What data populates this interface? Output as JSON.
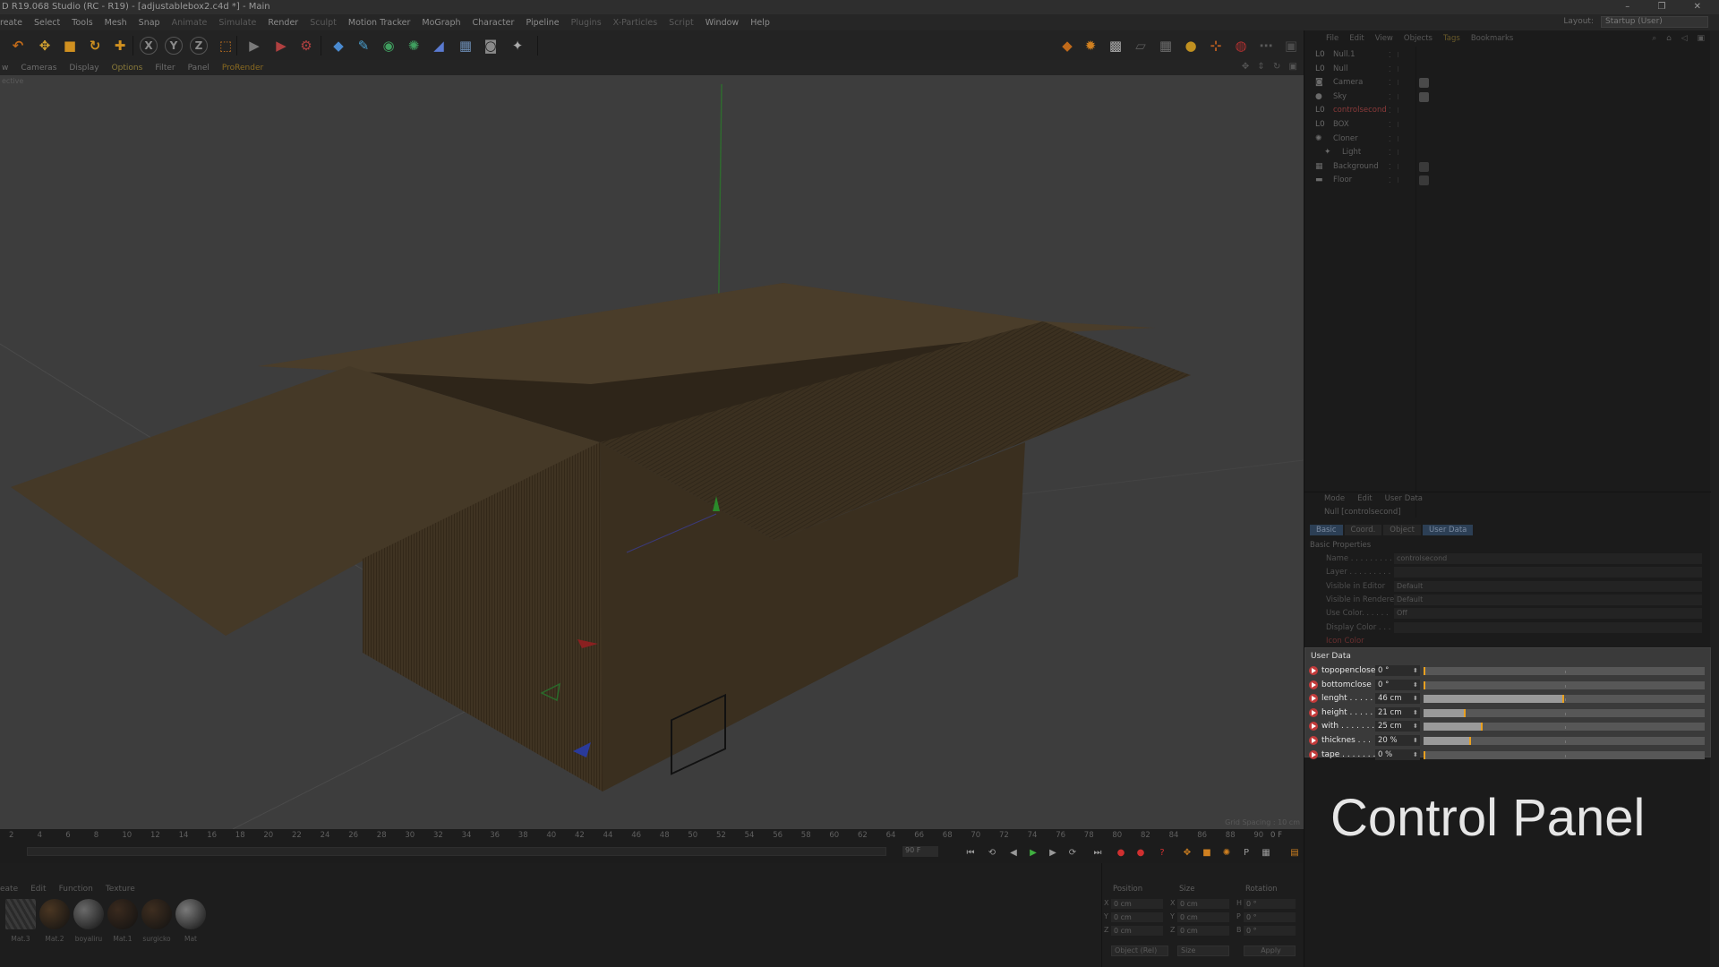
{
  "window": {
    "title": "D R19.068 Studio (RC - R19) - [adjustablebox2.c4d *] - Main",
    "controls": [
      "–",
      "❐",
      "✕"
    ]
  },
  "menubar": {
    "items": [
      "reate",
      "Select",
      "Tools",
      "Mesh",
      "Snap",
      "Animate",
      "Simulate",
      "Render",
      "Sculpt",
      "Motion Tracker",
      "MoGraph",
      "Character",
      "Pipeline",
      "Plugins",
      "X-Particles",
      "Script",
      "Window",
      "Help"
    ],
    "layout_label": "Layout:",
    "layout_value": "Startup (User)"
  },
  "toolbar": {
    "buttons": [
      {
        "icon": "undo-icon",
        "glyph": "↶",
        "color": "#c06a1a"
      },
      {
        "icon": "move-icon",
        "glyph": "✥",
        "color": "#d0a030"
      },
      {
        "icon": "scale-icon",
        "glyph": "■",
        "color": "#d09020"
      },
      {
        "icon": "rotate-icon",
        "glyph": "↻",
        "color": "#d09020"
      },
      {
        "icon": "add-icon",
        "glyph": "✚",
        "color": "#d09020"
      },
      {
        "icon": "x-axis-icon",
        "glyph": "X",
        "color": "#8a8a8a"
      },
      {
        "icon": "y-axis-icon",
        "glyph": "Y",
        "color": "#8a8a8a"
      },
      {
        "icon": "z-axis-icon",
        "glyph": "Z",
        "color": "#8a8a8a"
      },
      {
        "icon": "coord-system-icon",
        "glyph": "⬚",
        "color": "#c07020"
      },
      {
        "icon": "render-view-icon",
        "glyph": "▶",
        "color": "#7a7a7a"
      },
      {
        "icon": "render-picture-viewer-icon",
        "glyph": "▶",
        "color": "#b04040"
      },
      {
        "icon": "render-settings-icon",
        "glyph": "⚙",
        "color": "#b04040"
      },
      {
        "icon": "cube-icon",
        "glyph": "◆",
        "color": "#4a8ad0"
      },
      {
        "icon": "pen-icon",
        "glyph": "✎",
        "color": "#4aa0d0"
      },
      {
        "icon": "subdivision-icon",
        "glyph": "◉",
        "color": "#40a060"
      },
      {
        "icon": "array-icon",
        "glyph": "✺",
        "color": "#40a060"
      },
      {
        "icon": "deformer-icon",
        "glyph": "◢",
        "color": "#5a7ad0"
      },
      {
        "icon": "floor-icon",
        "glyph": "▦",
        "color": "#6a8ab0"
      },
      {
        "icon": "camera-icon",
        "glyph": "◙",
        "color": "#8a8a8a"
      },
      {
        "icon": "light-icon",
        "glyph": "✦",
        "color": "#aaaaaa"
      }
    ],
    "right_buttons": [
      {
        "icon": "snap-icon",
        "glyph": "◆",
        "color": "#c06a1a"
      },
      {
        "icon": "snap-settings-icon",
        "glyph": "✹",
        "color": "#d08020"
      },
      {
        "icon": "checker-icon",
        "glyph": "▩",
        "color": "#aaaaaa"
      },
      {
        "icon": "workplane-icon",
        "glyph": "▱",
        "color": "#5a5a5a"
      },
      {
        "icon": "grid-icon",
        "glyph": "▦",
        "color": "#6a6a6a"
      },
      {
        "icon": "sphere-light-icon",
        "glyph": "●",
        "color": "#c09020"
      },
      {
        "icon": "axis-lock-icon",
        "glyph": "⊹",
        "color": "#c06020"
      },
      {
        "icon": "magnet-icon",
        "glyph": "◍",
        "color": "#b03030"
      },
      {
        "icon": "extra-icon",
        "glyph": "⋯",
        "color": "#5a5a5a"
      },
      {
        "icon": "expand-icon",
        "glyph": "▣",
        "color": "#4a4a4a"
      }
    ]
  },
  "viewport_menu": {
    "items": [
      "w",
      "Cameras",
      "Display",
      "Options",
      "Filter",
      "Panel",
      "ProRender"
    ],
    "highlight_index": 3,
    "prorender_index": 6,
    "nav_icons": "✥ ⇕ ↻ ▣",
    "view_label": "ective",
    "grid_spacing": "Grid Spacing : 10 cm"
  },
  "timeline": {
    "ticks": [
      "2",
      "4",
      "6",
      "8",
      "10",
      "12",
      "14",
      "16",
      "18",
      "20",
      "22",
      "24",
      "26",
      "28",
      "30",
      "32",
      "34",
      "36",
      "38",
      "40",
      "42",
      "44",
      "46",
      "48",
      "50",
      "52",
      "54",
      "56",
      "58",
      "60",
      "62",
      "64",
      "66",
      "68",
      "70",
      "72",
      "74",
      "76",
      "78",
      "80",
      "82",
      "84",
      "86",
      "88",
      "90"
    ],
    "current_frame": "0 F",
    "start_field": "0 F",
    "end_field": "90 F",
    "transport": [
      {
        "icon": "goto-start-icon",
        "glyph": "⏮",
        "color": "#9a9a9a"
      },
      {
        "icon": "prev-key-icon",
        "glyph": "⟲",
        "color": "#9a9a9a"
      },
      {
        "icon": "prev-frame-icon",
        "glyph": "◀",
        "color": "#9a9a9a"
      },
      {
        "icon": "play-icon",
        "glyph": "▶",
        "color": "#40b040"
      },
      {
        "icon": "next-frame-icon",
        "glyph": "▶",
        "color": "#9a9a9a"
      },
      {
        "icon": "next-key-icon",
        "glyph": "⟳",
        "color": "#9a9a9a"
      },
      {
        "icon": "goto-end-icon",
        "glyph": "⏭",
        "color": "#9a9a9a"
      },
      {
        "icon": "record-icon",
        "glyph": "●",
        "color": "#d03030"
      },
      {
        "icon": "autokey-icon",
        "glyph": "●",
        "color": "#d03030"
      },
      {
        "icon": "keyframe-selection-icon",
        "glyph": "?",
        "color": "#d03030"
      },
      {
        "icon": "pos-key-icon",
        "glyph": "✥",
        "color": "#d08020"
      },
      {
        "icon": "scale-key-icon",
        "glyph": "■",
        "color": "#d08020"
      },
      {
        "icon": "rot-key-icon",
        "glyph": "✺",
        "color": "#d08020"
      },
      {
        "icon": "param-key-icon",
        "glyph": "P",
        "color": "#9a9a9a"
      },
      {
        "icon": "pla-key-icon",
        "glyph": "▦",
        "color": "#9a9a9a"
      },
      {
        "icon": "timeline-menu-icon",
        "glyph": "▤",
        "color": "#d08020"
      }
    ]
  },
  "materials": {
    "menu": [
      "eate",
      "Edit",
      "Function",
      "Texture"
    ],
    "items": [
      {
        "label": "Mat.3",
        "color": "#4a4a4a"
      },
      {
        "label": "Mat.2",
        "color": "#4a3622"
      },
      {
        "label": "boyaliru",
        "color": "#6a6a6a"
      },
      {
        "label": "Mat.1",
        "color": "#3a2a1e"
      },
      {
        "label": "surgicko",
        "color": "#3e2e20"
      },
      {
        "label": "Mat",
        "color": "#7a7a7a"
      }
    ]
  },
  "coordinates": {
    "headers": [
      "Position",
      "Size",
      "Rotation"
    ],
    "rows": [
      {
        "axis": "X",
        "pos": "0 cm",
        "size_axis": "X",
        "size": "0 cm",
        "rot_axis": "H",
        "rot": "0 °"
      },
      {
        "axis": "Y",
        "pos": "0 cm",
        "size_axis": "Y",
        "size": "0 cm",
        "rot_axis": "P",
        "rot": "0 °"
      },
      {
        "axis": "Z",
        "pos": "0 cm",
        "size_axis": "Z",
        "size": "0 cm",
        "rot_axis": "B",
        "rot": "0 °"
      }
    ],
    "mode_select": "Object (Rel)",
    "size_select": "Size",
    "apply_label": "Apply"
  },
  "object_manager": {
    "menu": [
      "File",
      "Edit",
      "View",
      "Objects",
      "Tags",
      "Bookmarks"
    ],
    "active_menu_index": 4,
    "objects": [
      {
        "name": "Null.1",
        "icon": "null-icon",
        "glyph": "L0",
        "red": false,
        "tag": ""
      },
      {
        "name": "Null",
        "icon": "null-icon",
        "glyph": "L0",
        "red": false,
        "tag": ""
      },
      {
        "name": "Camera",
        "icon": "camera-icon",
        "glyph": "◙",
        "red": false,
        "tag": "#4a4a4a"
      },
      {
        "name": "Sky",
        "icon": "sky-icon",
        "glyph": "●",
        "red": false,
        "tag": "#4a4a4a"
      },
      {
        "name": "controlsecond",
        "icon": "null-icon",
        "glyph": "L0",
        "red": true,
        "tag": ""
      },
      {
        "name": "BOX",
        "icon": "null-icon",
        "glyph": "L0",
        "red": false,
        "tag": ""
      },
      {
        "name": "Cloner",
        "icon": "cloner-icon",
        "glyph": "✺",
        "red": false,
        "tag": ""
      },
      {
        "name": "Light",
        "icon": "light-icon",
        "glyph": "✦",
        "red": false,
        "tag": ""
      },
      {
        "name": "Background",
        "icon": "background-icon",
        "glyph": "▦",
        "red": false,
        "tag": "#3a3a3a"
      },
      {
        "name": "Floor",
        "icon": "floor-icon",
        "glyph": "▬",
        "red": false,
        "tag": "#3a3a3a"
      }
    ]
  },
  "attribute_manager": {
    "menu": [
      "Mode",
      "Edit",
      "User Data"
    ],
    "title": "Null [controlsecond]",
    "tabs": [
      "Basic",
      "Coord.",
      "Object",
      "User Data"
    ],
    "active_tabs": [
      0,
      3
    ],
    "basic_header": "Basic Properties",
    "basic_rows": [
      {
        "label": "Name . . . . . . . . .",
        "value": "controlsecond",
        "red": false
      },
      {
        "label": "Layer . . . . . . . . .",
        "value": "",
        "red": false
      },
      {
        "label": "Visible in Editor",
        "value": "Default",
        "red": false
      },
      {
        "label": "Visible in Renderer",
        "value": "Default",
        "red": false
      },
      {
        "label": "Use Color. . . . . .",
        "value": "Off",
        "red": false
      },
      {
        "label": "Display Color . . .",
        "value": "",
        "red": false
      },
      {
        "label": "Icon Color",
        "value": "",
        "red": true
      }
    ]
  },
  "user_data": {
    "header": "User Data",
    "params": [
      {
        "label": "topopenclose",
        "value": "0 °",
        "fraction": 0.0
      },
      {
        "label": "bottomclose",
        "value": "0 °",
        "fraction": 0.0
      },
      {
        "label": "lenght . . . . .",
        "value": "46 cm",
        "fraction": 0.5
      },
      {
        "label": "height . . . . .",
        "value": "21 cm",
        "fraction": 0.15
      },
      {
        "label": "with . . . . . . .",
        "value": "25 cm",
        "fraction": 0.21
      },
      {
        "label": "thicknes . . .",
        "value": "20 %",
        "fraction": 0.17
      },
      {
        "label": "tape . . . . . . .",
        "value": "0 %",
        "fraction": 0.0
      }
    ]
  },
  "caption": "Control Panel"
}
